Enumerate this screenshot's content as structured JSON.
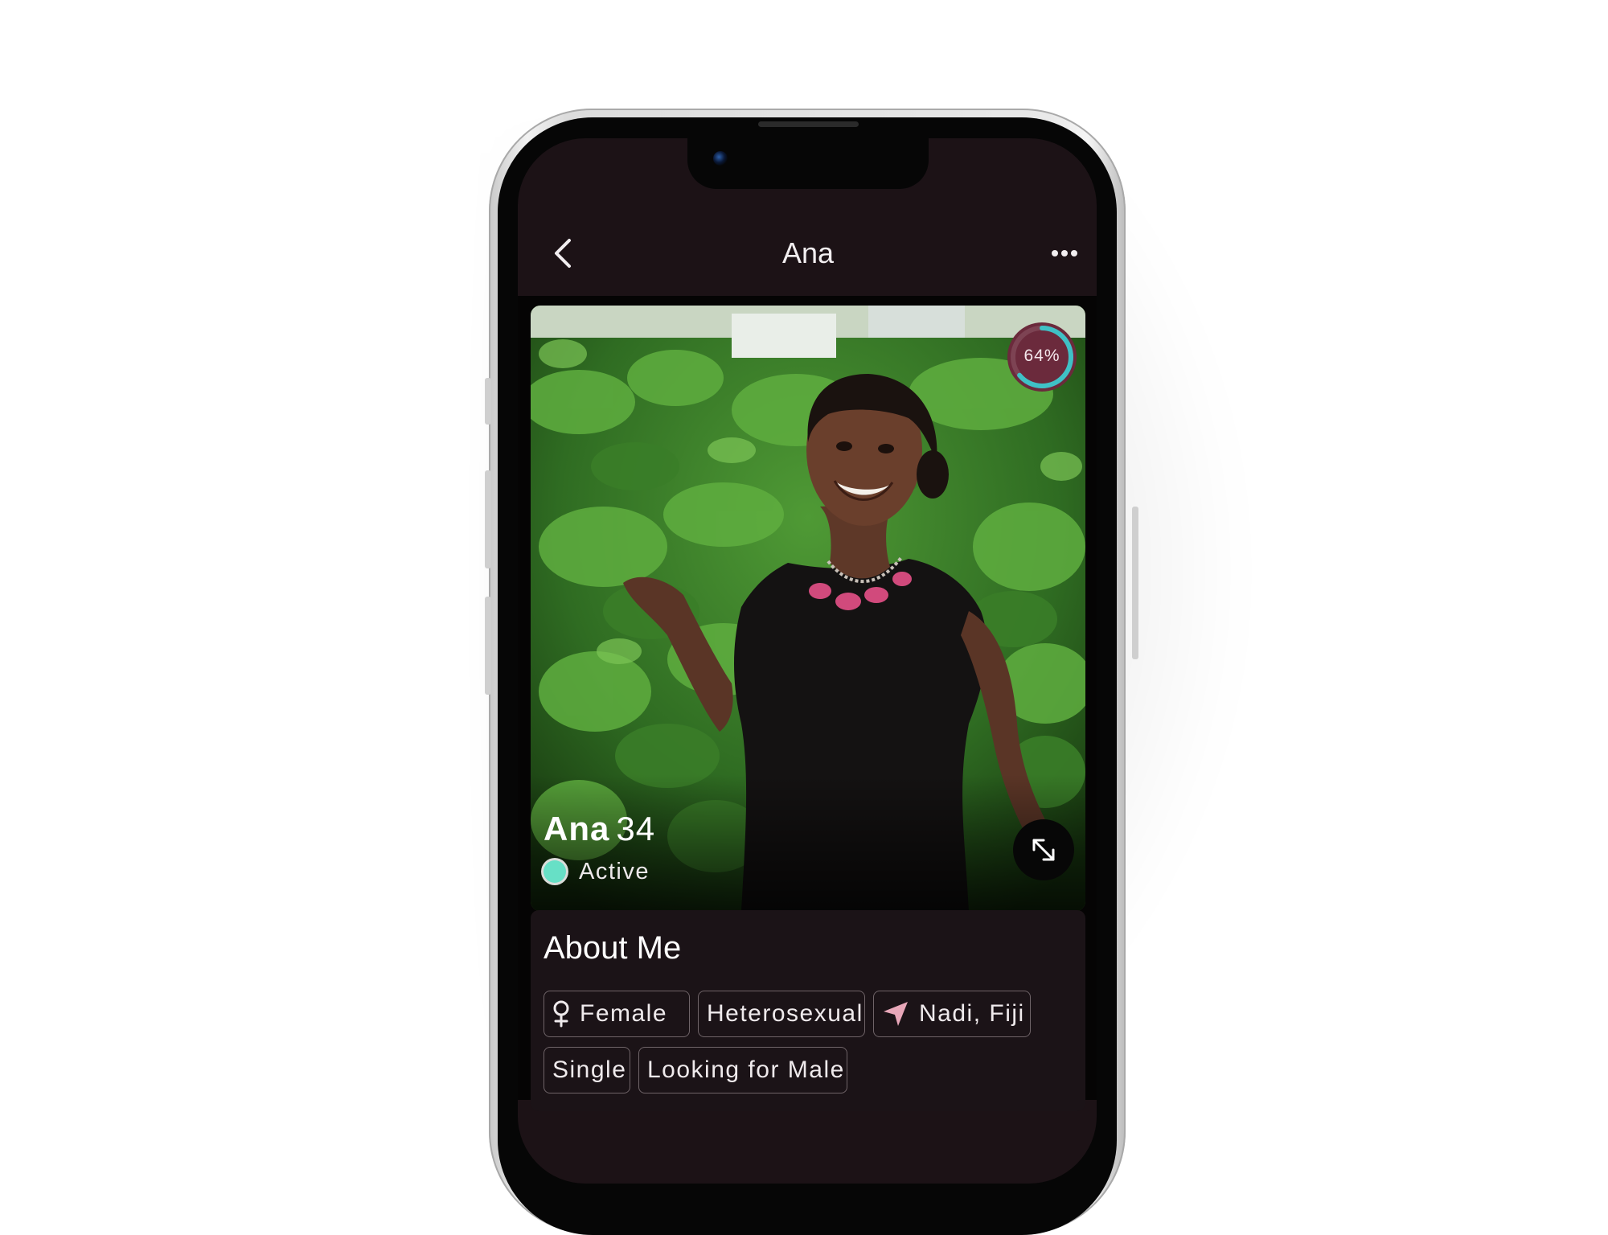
{
  "header": {
    "title": "Ana",
    "back_icon": "chevron-left-icon",
    "more_icon": "ellipsis-icon"
  },
  "photo": {
    "match_percent": 64,
    "match_label": "64%",
    "match_ring_color": "#3fc1c6",
    "match_fill_color": "#6b2a3c",
    "expand_icon": "expand-arrows-icon"
  },
  "profile": {
    "name": "Ana",
    "age": "34",
    "status": "Active",
    "status_color": "#67e0c6"
  },
  "about": {
    "title": "About Me",
    "chips": [
      {
        "label": "Female",
        "icon": "female-icon"
      },
      {
        "label": "Heterosexual"
      },
      {
        "label": "Nadi, Fiji",
        "icon": "location-arrow-icon"
      },
      {
        "label": "Single"
      },
      {
        "label": "Looking for Male"
      }
    ]
  },
  "colors": {
    "screen_background": "#1c1216",
    "card_background": "#1b1317",
    "chip_border": "#6f6468",
    "accent_pink": "#e8a7b9"
  }
}
